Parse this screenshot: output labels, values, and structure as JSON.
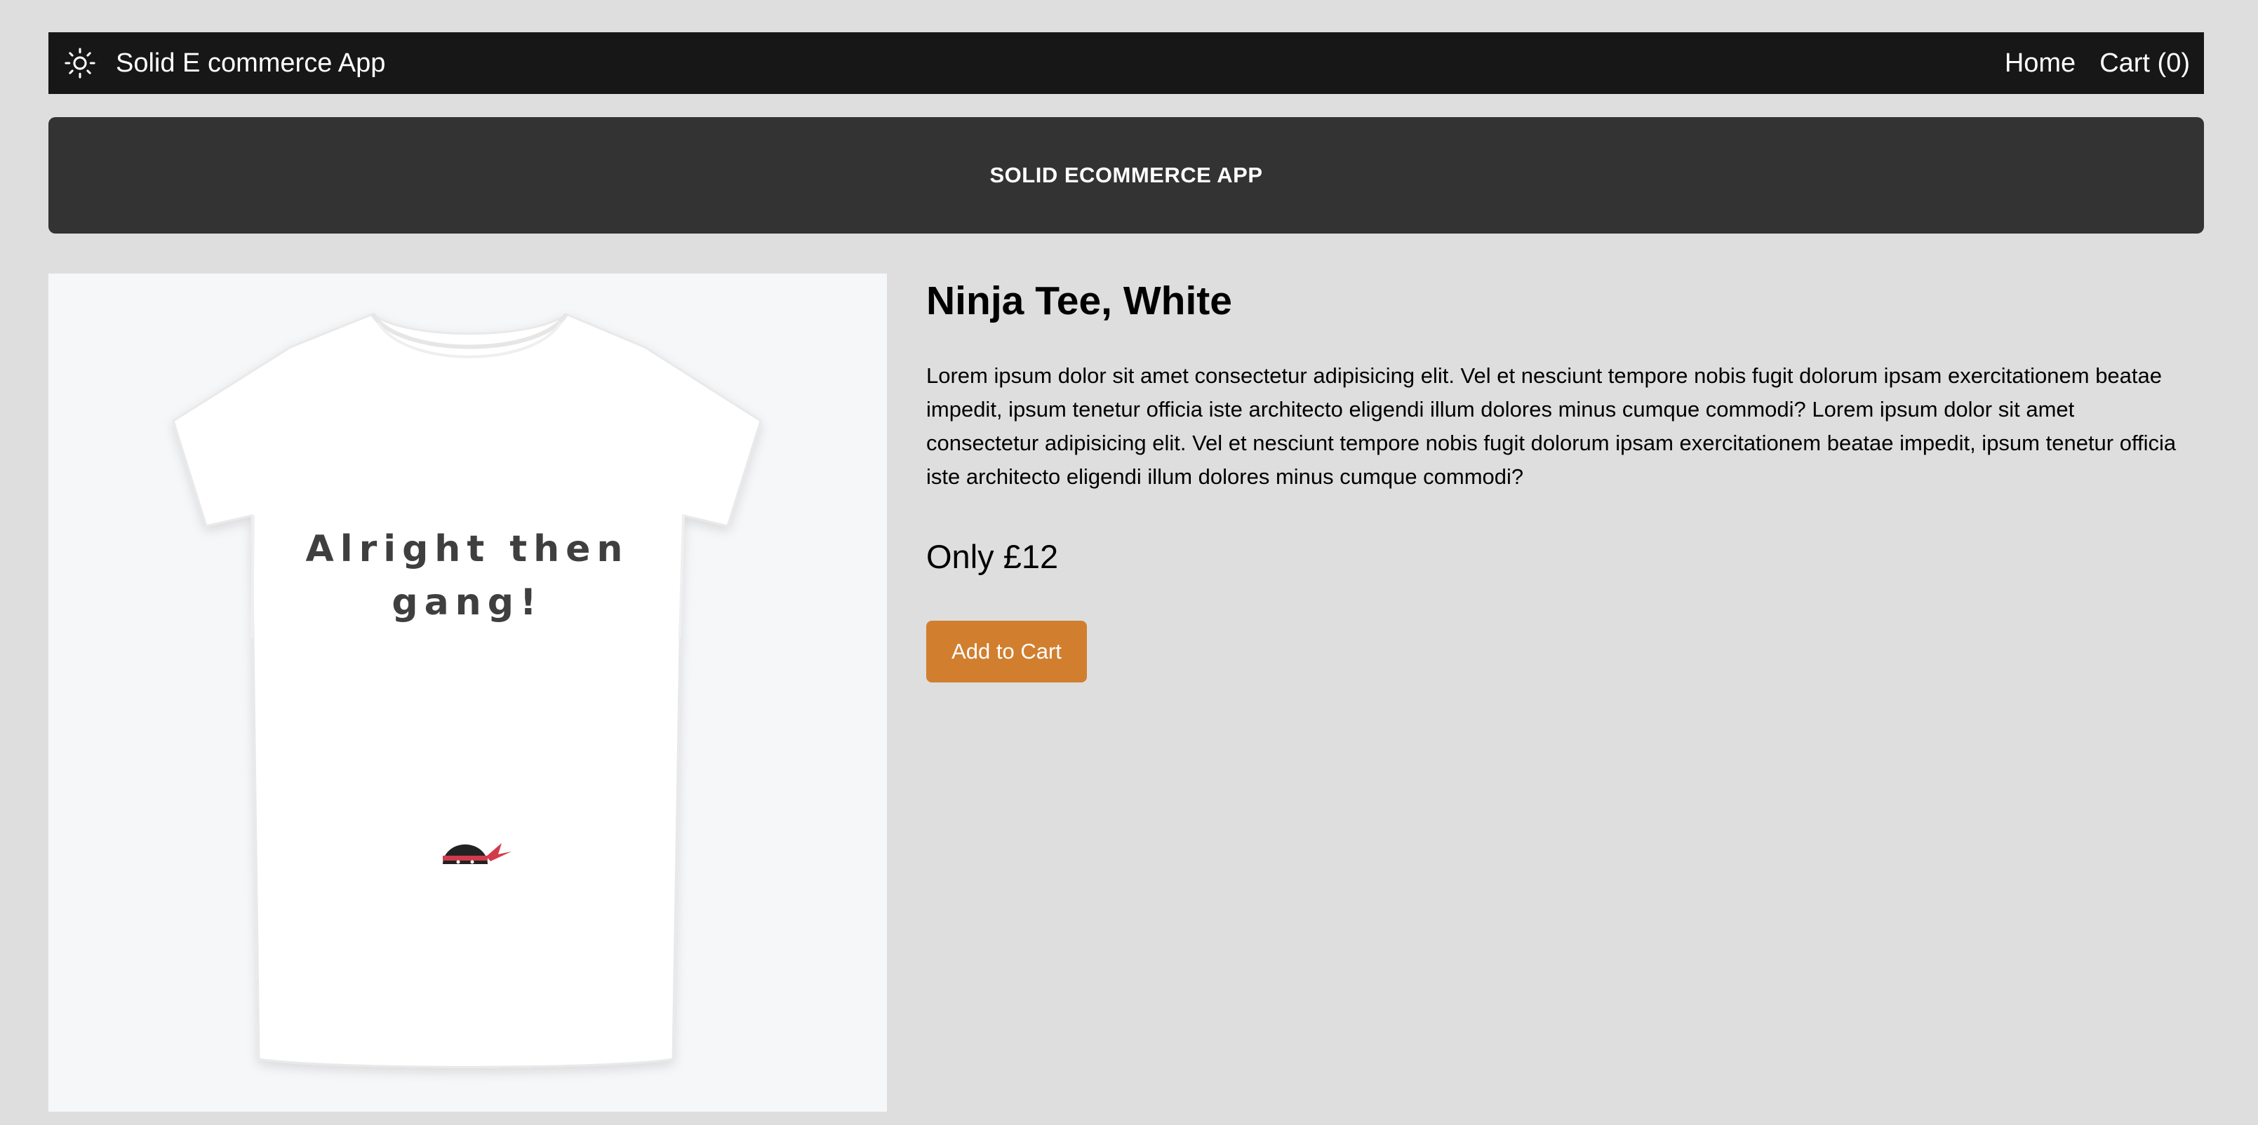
{
  "header": {
    "app_name": "Solid E commerce App",
    "theme_icon": "sun-icon",
    "nav": {
      "home_label": "Home",
      "cart_label": "Cart (0)"
    }
  },
  "banner": {
    "title": "SOLID ECOMMERCE APP"
  },
  "product": {
    "title": "Ninja Tee, White",
    "description": "Lorem ipsum dolor sit amet consectetur adipisicing elit. Vel et nesciunt tempore nobis fugit dolorum ipsam exercitationem beatae impedit, ipsum tenetur officia iste architecto eligendi illum dolores minus cumque commodi? Lorem ipsum dolor sit amet consectetur adipisicing elit. Vel et nesciunt tempore nobis fugit dolorum ipsam exercitationem beatae impedit, ipsum tenetur officia iste architecto eligendi illum dolores minus cumque commodi?",
    "price": "Only £12",
    "add_to_cart_label": "Add to Cart",
    "image": {
      "print_line1": "Alright then",
      "print_line2": "gang!"
    }
  },
  "colors": {
    "navbar_bg": "#171717",
    "banner_bg": "#333333",
    "page_bg": "#dedede",
    "accent": "#d17f2f"
  }
}
